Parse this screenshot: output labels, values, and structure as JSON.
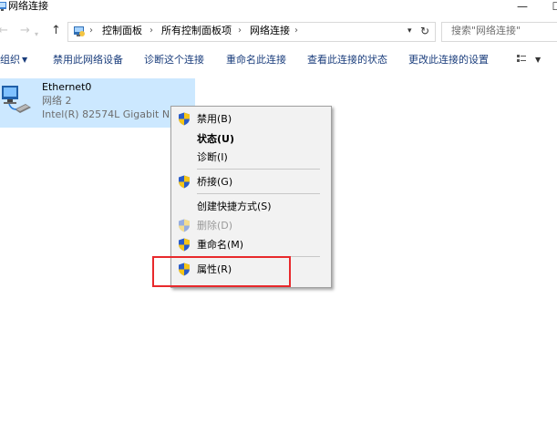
{
  "window": {
    "title": "网络连接",
    "minimize": "—",
    "maximize": "☐"
  },
  "address": {
    "crumbs": [
      "控制面板",
      "所有控制面板项",
      "网络连接"
    ],
    "search_placeholder": "搜索\"网络连接\""
  },
  "toolbar": {
    "organize": "组织",
    "commands": [
      "禁用此网络设备",
      "诊断这个连接",
      "重命名此连接",
      "查看此连接的状态",
      "更改此连接的设置"
    ]
  },
  "connection": {
    "name": "Ethernet0",
    "network": "网络 2",
    "device": "Intel(R) 82574L Gigabit Network Connection"
  },
  "context_menu": {
    "items": [
      {
        "label": "禁用(B)",
        "icon": "shield-icon"
      },
      {
        "label": "状态(U)",
        "bold": true
      },
      {
        "label": "诊断(I)"
      },
      {
        "label": "桥接(G)",
        "icon": "shield-icon"
      },
      {
        "label": "创建快捷方式(S)"
      },
      {
        "label": "删除(D)",
        "icon": "shield-icon",
        "disabled": true
      },
      {
        "label": "重命名(M)",
        "icon": "shield-icon"
      },
      {
        "label": "属性(R)",
        "icon": "shield-icon",
        "highlighted": true
      }
    ]
  },
  "colors": {
    "selection": "#cce8ff",
    "highlight_box": "#e8292c",
    "command_text": "#1a3d7c"
  }
}
